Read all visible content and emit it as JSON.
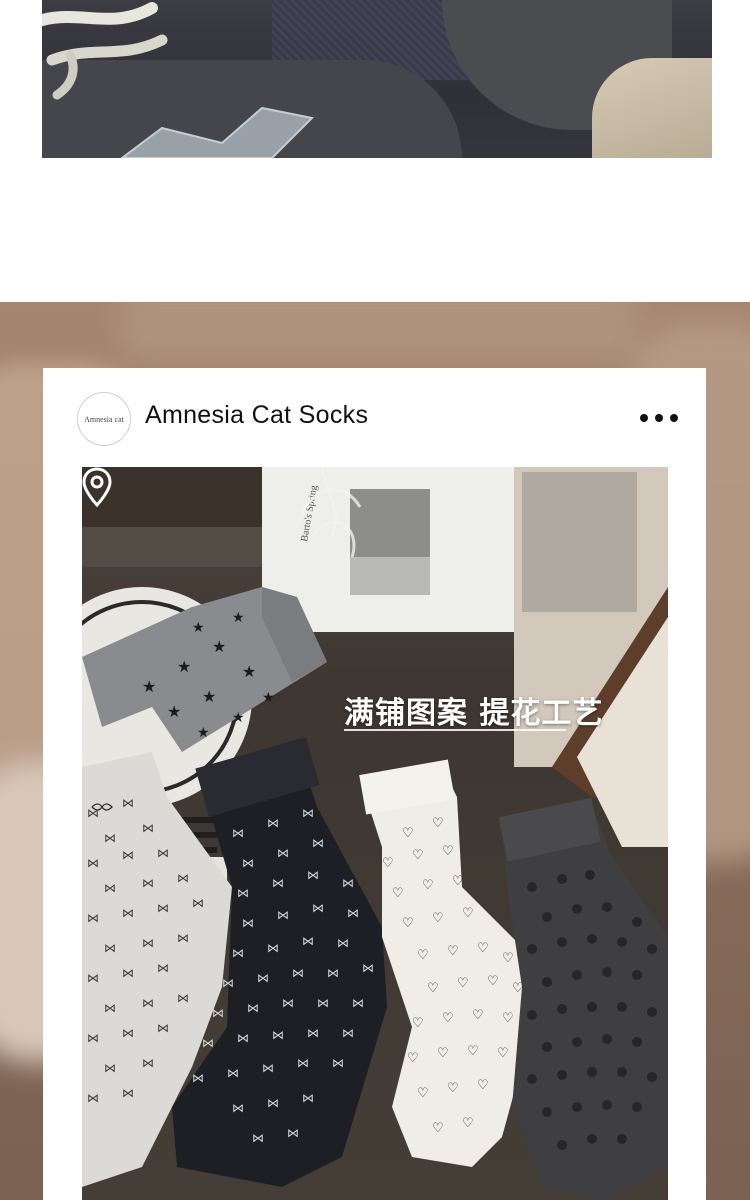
{
  "post": {
    "avatar_text": "Amnesia cat",
    "account_name": "Amnesia Cat Socks",
    "more_icon": "more-horizontal-icon",
    "location_icon": "location-pin-icon",
    "caption": "满铺图案 提花工艺"
  },
  "colors": {
    "card_bg": "#ffffff",
    "text": "#111111",
    "caption": "#ffffff"
  }
}
